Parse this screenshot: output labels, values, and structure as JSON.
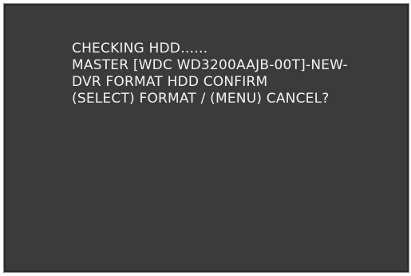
{
  "screen": {
    "background_color": "#3b3b3b",
    "text_color": "#f2f2f2",
    "lines": [
      "CHECKING HDD……",
      "MASTER [WDC WD3200AAJB-00T]-NEW-",
      "DVR FORMAT HDD CONFIRM",
      "(SELECT) FORMAT / (MENU) CANCEL?"
    ]
  }
}
